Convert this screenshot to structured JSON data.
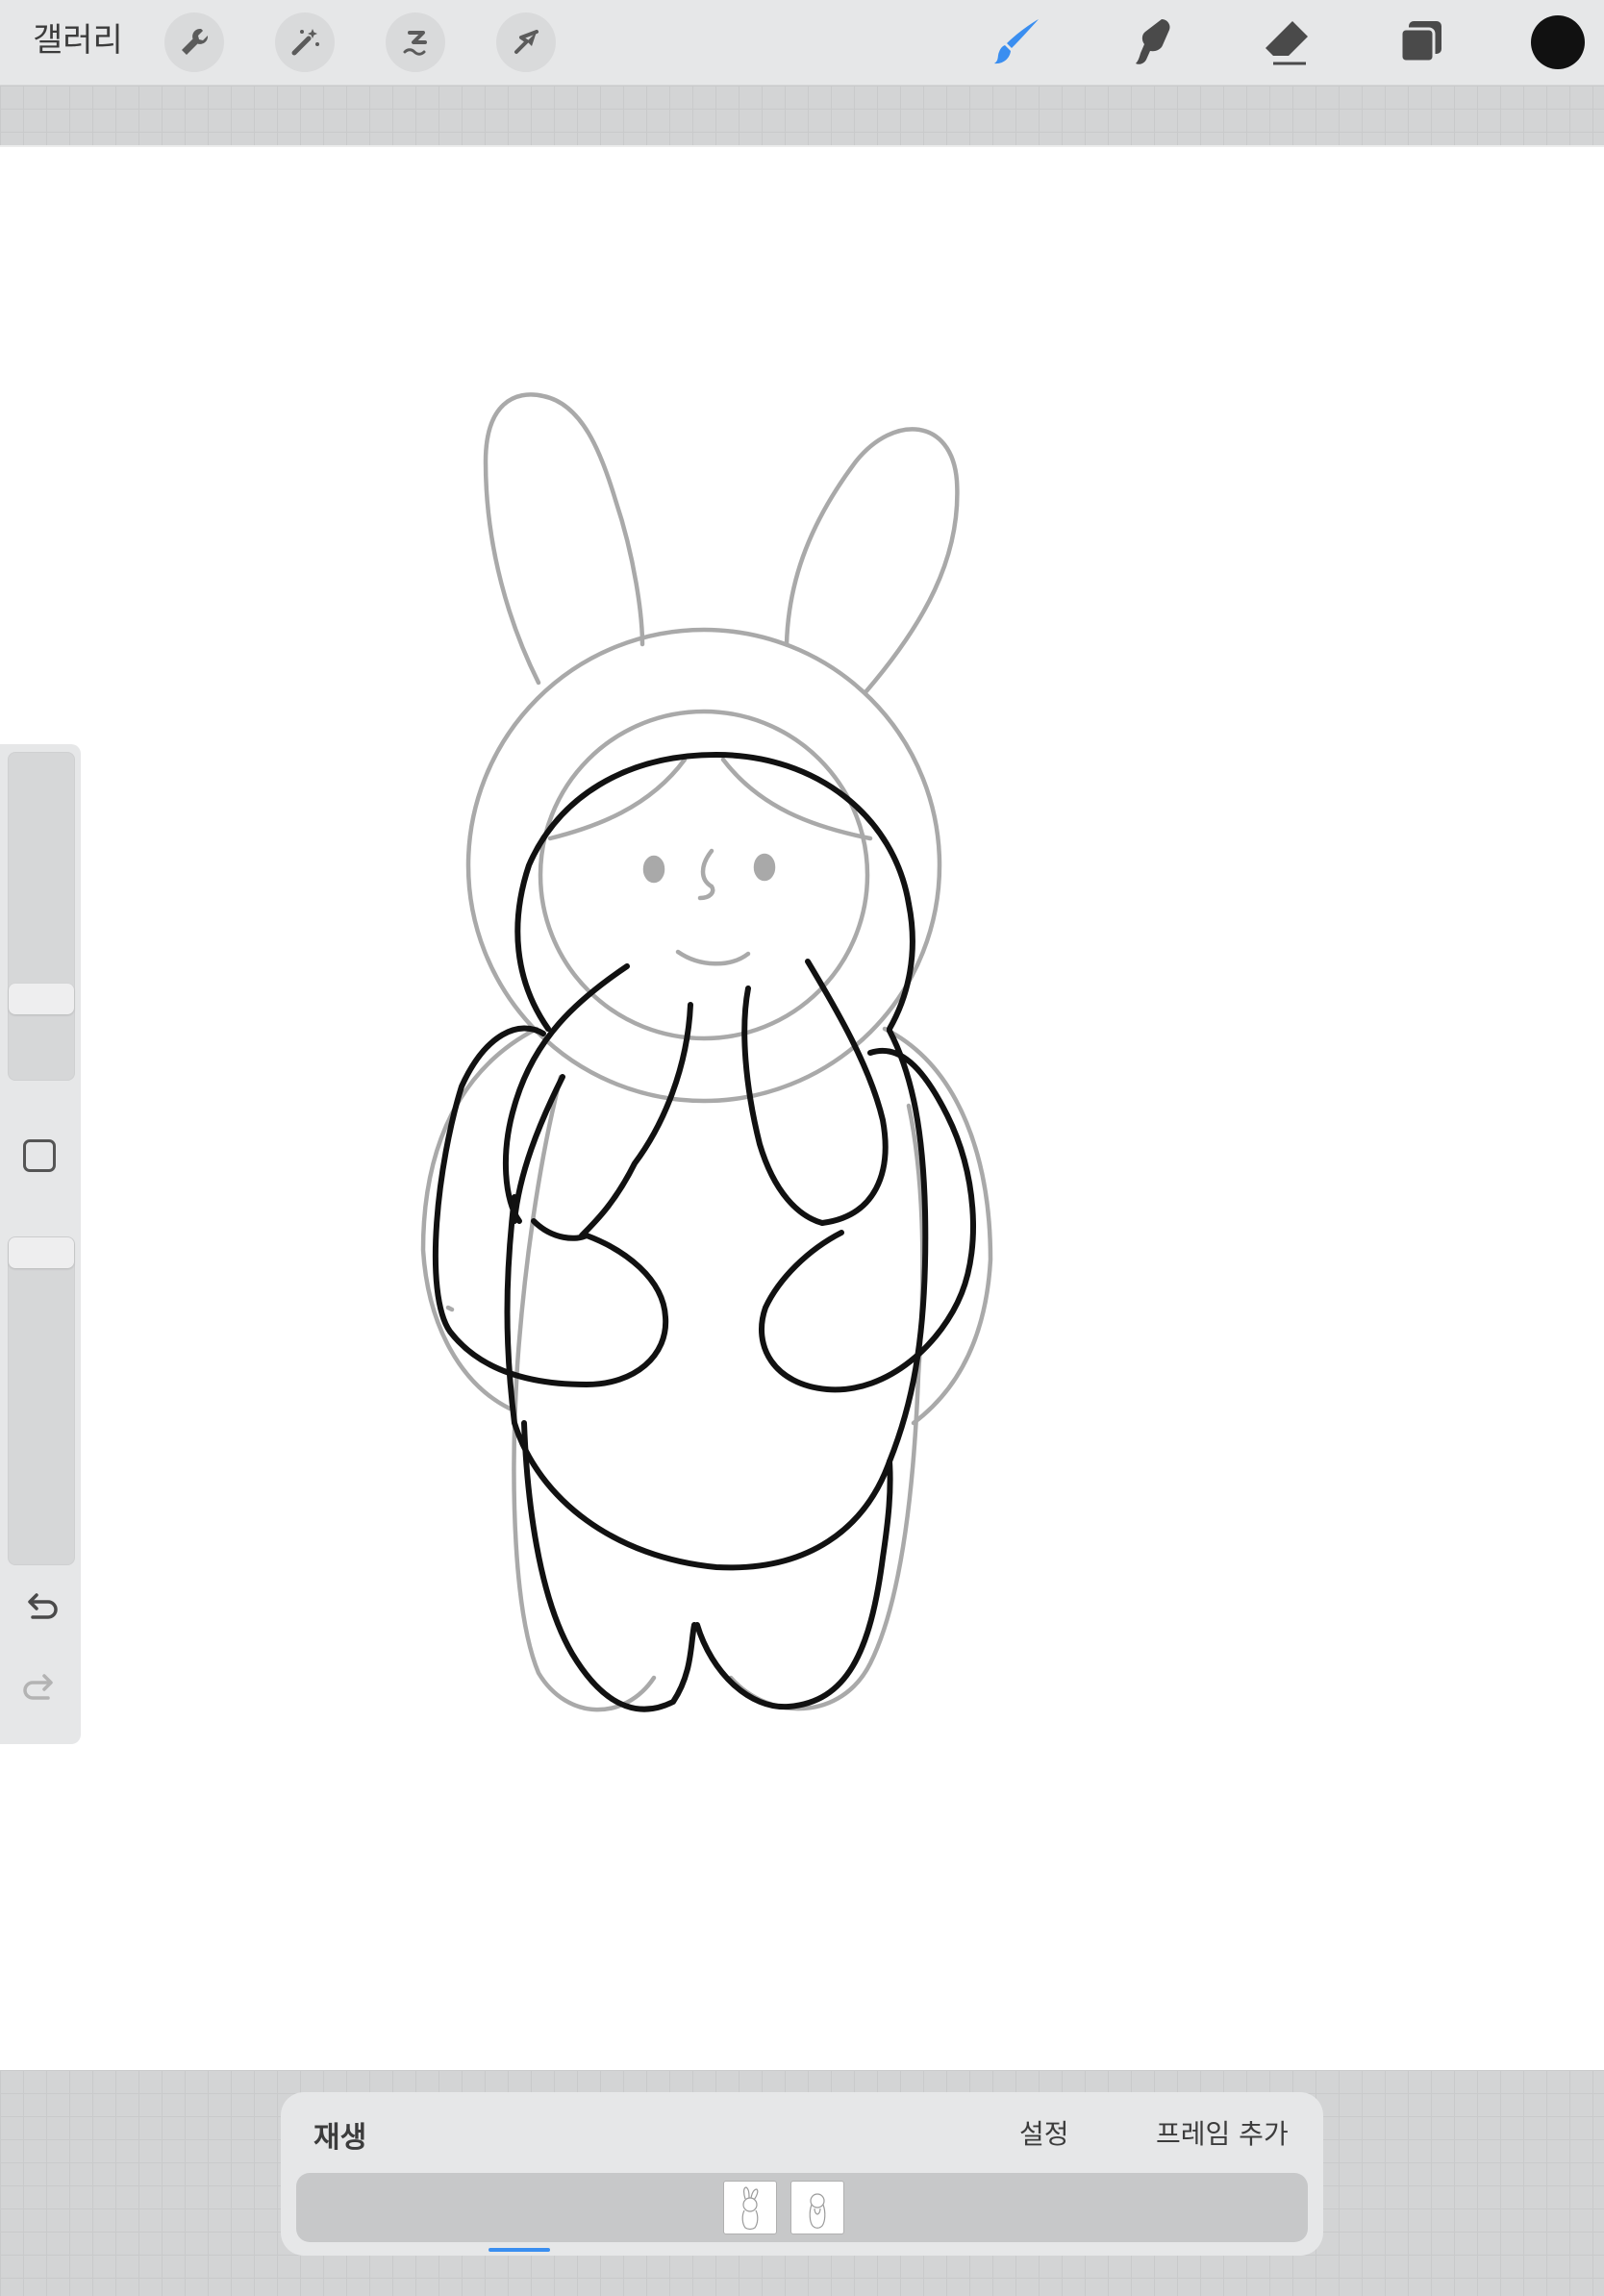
{
  "toolbar": {
    "gallery_label": "갤러리",
    "left_tools": [
      "wrench-icon",
      "magic-wand-icon",
      "selection-icon",
      "transform-arrow-icon"
    ],
    "right_tools": [
      "brush-icon",
      "smudge-icon",
      "eraser-icon",
      "layers-icon"
    ],
    "active_tool": "brush",
    "active_color": "#111111",
    "accent_color": "#3a8ef0"
  },
  "sidebar": {
    "controls": [
      "brush-size-slider",
      "modify-button",
      "opacity-slider",
      "undo-icon",
      "redo-icon"
    ]
  },
  "canvas": {
    "drawing": "rabbit-hood character sketch, onion-skin previous frame in grey"
  },
  "animation_assist": {
    "play_label": "재생",
    "settings_label": "설정",
    "add_frame_label": "프레임 추가",
    "frames": 2,
    "selected_frame": 2
  }
}
